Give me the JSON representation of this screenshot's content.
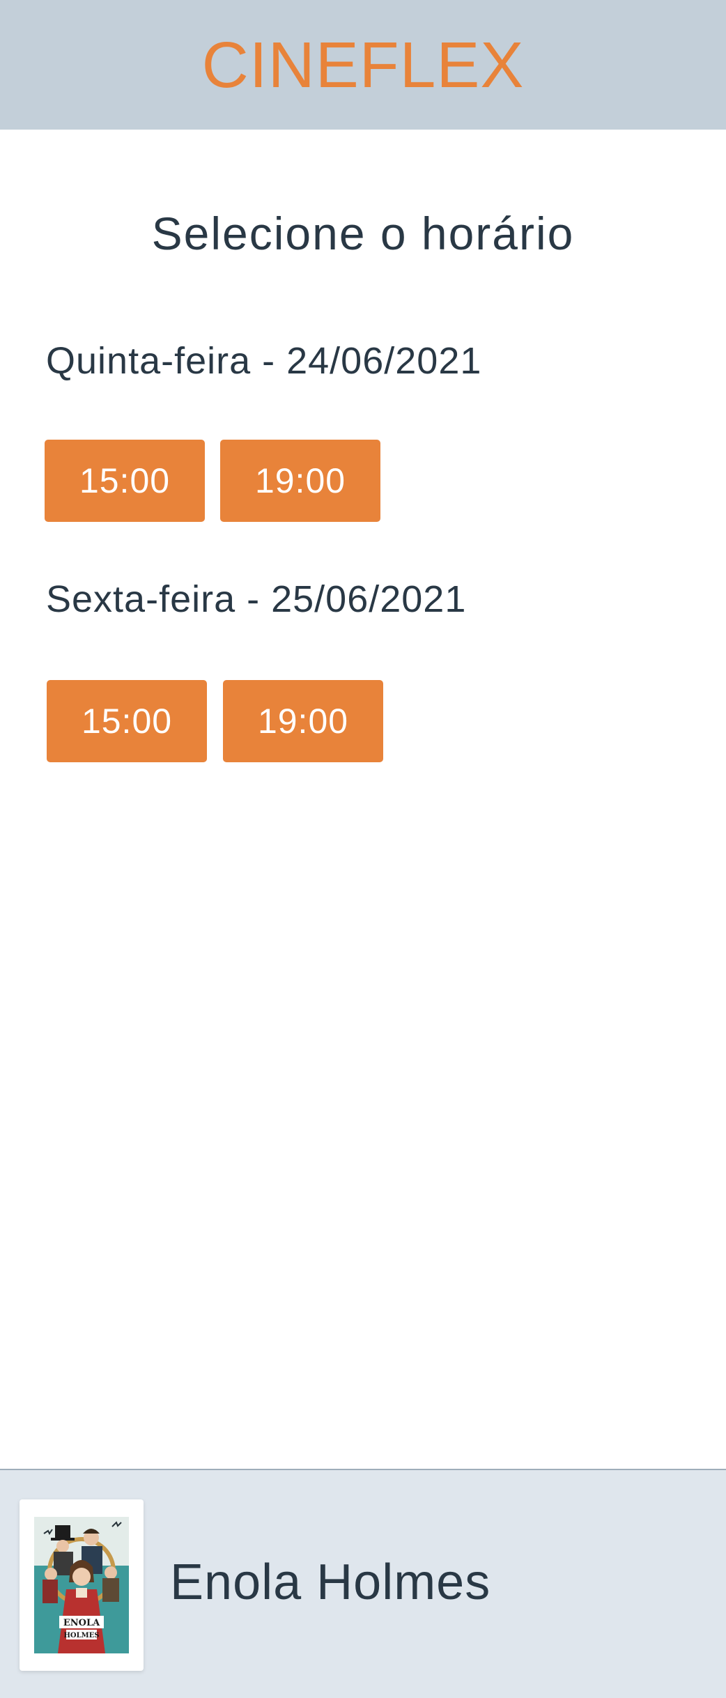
{
  "header": {
    "brand": "CINEFLEX"
  },
  "page": {
    "title": "Selecione o horário"
  },
  "sessions": [
    {
      "day_label": "Quinta-feira - 24/06/2021",
      "times": [
        "15:00",
        "19:00"
      ]
    },
    {
      "day_label": "Sexta-feira - 25/06/2021",
      "times": [
        "15:00",
        "19:00"
      ]
    }
  ],
  "footer": {
    "movie_title": "Enola Holmes",
    "poster_text_top": "ENOLA",
    "poster_text_bottom": "HOLMES",
    "poster_icon": "movie-poster-icon"
  },
  "colors": {
    "accent": "#e8833a",
    "header_bg": "#c3cfd9",
    "footer_bg": "#dfe6ed",
    "text": "#293845"
  }
}
